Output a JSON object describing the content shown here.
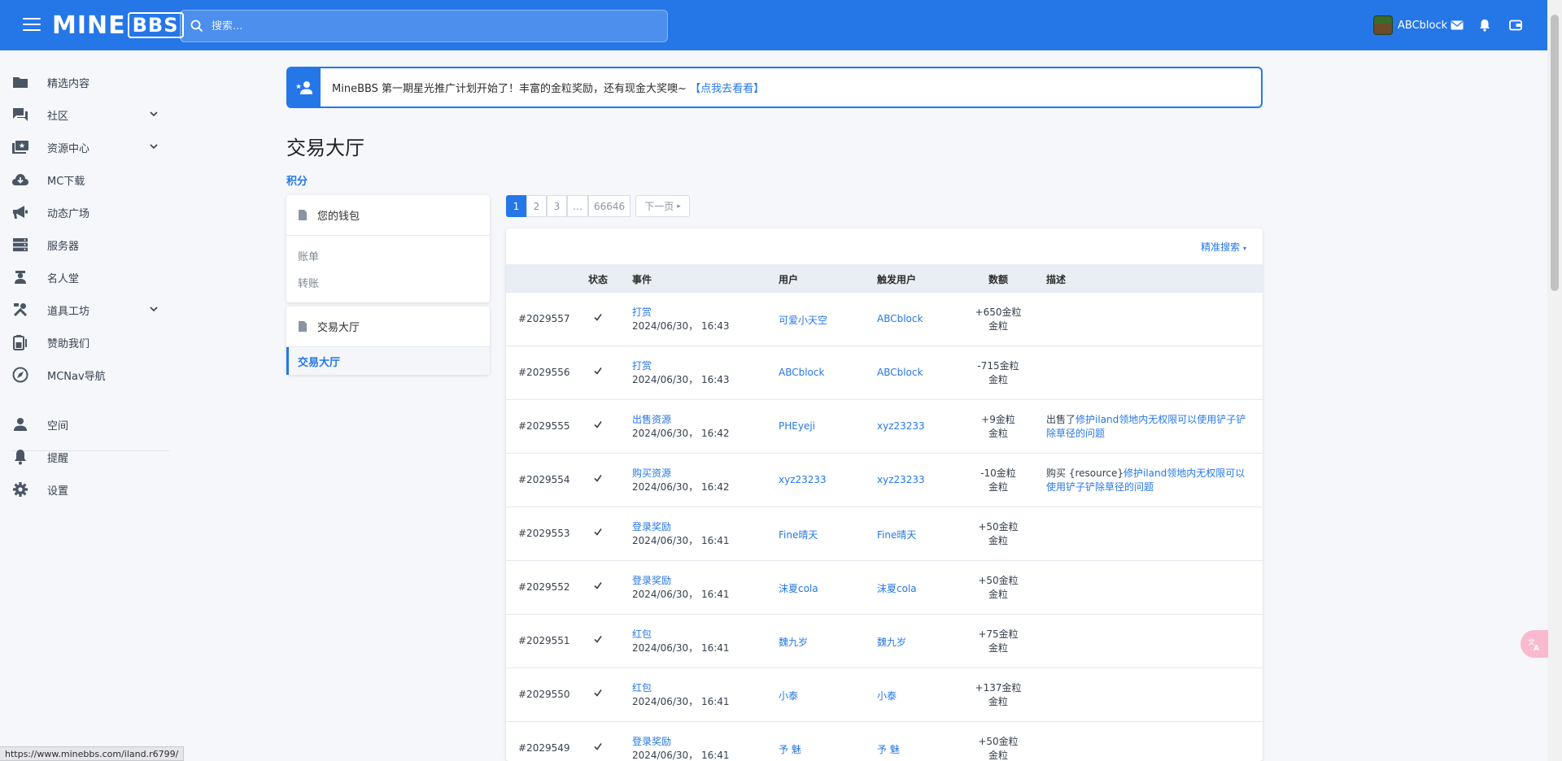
{
  "header": {
    "logo_part1": "MINE",
    "logo_part2": "BBS",
    "search_placeholder": "搜索...",
    "username": "ABCblock"
  },
  "sidebar": {
    "items": [
      {
        "label": "精选内容",
        "icon": "folder-icon",
        "has_chevron": false
      },
      {
        "label": "社区",
        "icon": "chat-icon",
        "has_chevron": true
      },
      {
        "label": "资源中心",
        "icon": "resources-icon",
        "has_chevron": true
      },
      {
        "label": "MC下载",
        "icon": "cloud-download-icon",
        "has_chevron": false
      },
      {
        "label": "动态广场",
        "icon": "megaphone-icon",
        "has_chevron": false
      },
      {
        "label": "服务器",
        "icon": "server-icon",
        "has_chevron": false
      },
      {
        "label": "名人堂",
        "icon": "person-icon",
        "has_chevron": false
      },
      {
        "label": "道具工坊",
        "icon": "tools-icon",
        "has_chevron": true
      },
      {
        "label": "赞助我们",
        "icon": "battery-icon",
        "has_chevron": false
      },
      {
        "label": "MCNav导航",
        "icon": "compass-icon",
        "has_chevron": false
      }
    ],
    "bottom_items": [
      {
        "label": "空间",
        "icon": "user-icon"
      },
      {
        "label": "提醒",
        "icon": "bell-icon"
      },
      {
        "label": "设置",
        "icon": "gear-icon"
      }
    ]
  },
  "notice": {
    "text": "MineBBS 第一期星光推广计划开始了！丰富的金粒奖励，还有现金大奖噢~ ",
    "link": "【点我去看看】"
  },
  "page": {
    "title": "交易大厅",
    "breadcrumb": "积分"
  },
  "wallet_block": {
    "title": "您的钱包",
    "links": [
      "账单",
      "转账"
    ]
  },
  "hall_block": {
    "title": "交易大厅",
    "active_link": "交易大厅"
  },
  "pager": {
    "pages": [
      "1",
      "2",
      "3",
      "…",
      "66646"
    ],
    "next": "下一页"
  },
  "table": {
    "filter_label": "精准搜索",
    "headers": {
      "status": "状态",
      "event": "事件",
      "user": "用户",
      "trigger": "触发用户",
      "amount": "数额",
      "desc": "描述"
    },
    "rows": [
      {
        "id": "#2029557",
        "event": "打赏",
        "time": "2024/06/30， 16:43",
        "user": "可爱小天空",
        "trigger": "ABCblock",
        "amount1": "+650金粒",
        "amount2": "金粒",
        "desc_prefix": "",
        "desc_link": "",
        "desc_text": ""
      },
      {
        "id": "#2029556",
        "event": "打赏",
        "time": "2024/06/30， 16:43",
        "user": "ABCblock",
        "trigger": "ABCblock",
        "amount1": "-715金粒",
        "amount2": "金粒",
        "desc_prefix": "",
        "desc_link": "",
        "desc_text": ""
      },
      {
        "id": "#2029555",
        "event": "出售资源",
        "time": "2024/06/30， 16:42",
        "user": "PHEyeji",
        "trigger": "xyz23233",
        "amount1": "+9金粒",
        "amount2": "金粒",
        "desc_prefix": "出售了",
        "desc_link": "修护iland领地内无权限可以使用铲子铲除草径的问题",
        "desc_text": ""
      },
      {
        "id": "#2029554",
        "event": "购买资源",
        "time": "2024/06/30， 16:42",
        "user": "xyz23233",
        "trigger": "xyz23233",
        "amount1": "-10金粒",
        "amount2": "金粒",
        "desc_prefix": "购买 {resource}",
        "desc_link": "修护iland领地内无权限可以使用铲子铲除草径的问题",
        "desc_text": ""
      },
      {
        "id": "#2029553",
        "event": "登录奖励",
        "time": "2024/06/30， 16:41",
        "user": "Fine晴天",
        "trigger": "Fine晴天",
        "amount1": "+50金粒",
        "amount2": "金粒",
        "desc_prefix": "",
        "desc_link": "",
        "desc_text": ""
      },
      {
        "id": "#2029552",
        "event": "登录奖励",
        "time": "2024/06/30， 16:41",
        "user": "沫夏cola",
        "trigger": "沫夏cola",
        "amount1": "+50金粒",
        "amount2": "金粒",
        "desc_prefix": "",
        "desc_link": "",
        "desc_text": ""
      },
      {
        "id": "#2029551",
        "event": "红包",
        "time": "2024/06/30， 16:41",
        "user": "魏九岁",
        "trigger": "魏九岁",
        "amount1": "+75金粒",
        "amount2": "金粒",
        "desc_prefix": "",
        "desc_link": "",
        "desc_text": ""
      },
      {
        "id": "#2029550",
        "event": "红包",
        "time": "2024/06/30， 16:41",
        "user": "小泰",
        "trigger": "小泰",
        "amount1": "+137金粒",
        "amount2": "金粒",
        "desc_prefix": "",
        "desc_link": "",
        "desc_text": ""
      },
      {
        "id": "#2029549",
        "event": "登录奖励",
        "time": "2024/06/30， 16:41",
        "user": "予 魅",
        "trigger": "予 魅",
        "amount1": "+50金粒",
        "amount2": "金粒",
        "desc_prefix": "",
        "desc_link": "",
        "desc_text": ""
      }
    ]
  },
  "status_bar": "https://www.minebbs.com/iland.r6799/",
  "colors": {
    "accent": "#2577e8",
    "bg": "#f5f7fb"
  }
}
